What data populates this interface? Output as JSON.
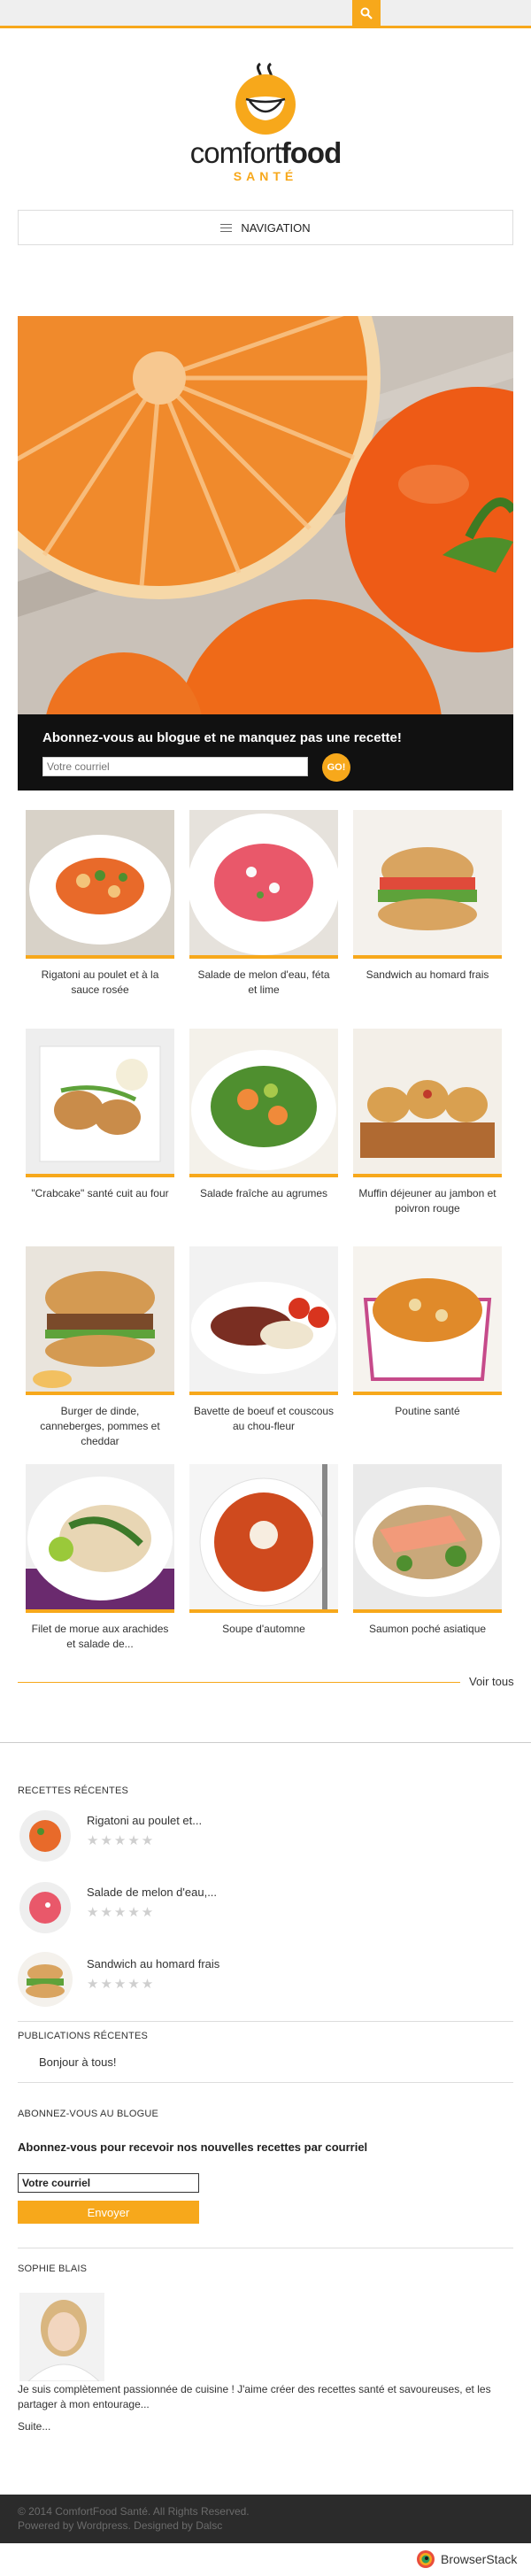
{
  "header": {
    "brand_main": "comfort",
    "brand_bold": "food",
    "brand_sub": "SANTÉ",
    "nav_label": "NAVIGATION"
  },
  "colors": {
    "accent": "#f7a81b",
    "dark": "#111111",
    "footer_bg": "#2b2b2b"
  },
  "subscribe_banner": {
    "title": "Abonnez-vous au blogue et ne manquez pas une recette!",
    "placeholder": "Votre courriel",
    "button": "GO!"
  },
  "recipes": [
    "Rigatoni au poulet et à la sauce rosée",
    "Salade de melon d'eau, féta et lime",
    "Sandwich au homard frais",
    "\"Crabcake\" santé cuit au four",
    "Salade fraîche au agrumes",
    "Muffin déjeuner au jambon et poivron rouge",
    "Burger de dinde, canneberges, pommes et cheddar",
    "Bavette de boeuf et couscous au chou-fleur",
    "Poutine santé",
    "Filet de morue aux arachides et salade de...",
    "Soupe d'automne",
    "Saumon poché asiatique"
  ],
  "see_all": "Voir tous",
  "sidebar": {
    "recent_recipes_title": "RECETTES RÉCENTES",
    "recent_recipes": [
      "Rigatoni au poulet et...",
      "Salade de melon d'eau,...",
      "Sandwich au homard frais"
    ],
    "stars": "★★★★★",
    "recent_posts_title": "PUBLICATIONS RÉCENTES",
    "recent_posts": [
      "Bonjour à tous!"
    ],
    "newsletter_title": "ABONNEZ-VOUS AU BLOGUE",
    "newsletter_text": "Abonnez-vous pour recevoir nos nouvelles recettes par courriel",
    "newsletter_value": "Votre courriel",
    "newsletter_button": "Envoyer",
    "author_title": "SOPHIE BLAIS",
    "author_bio": "Je suis complètement passionnée de cuisine ! J'aime créer des recettes santé et savoureuses, et les partager à mon entourage...",
    "author_more": "Suite..."
  },
  "footer": {
    "line1": "© 2014 ComfortFood Santé. All Rights Reserved.",
    "line2": "Powered by Wordpress. Designed by Dalsc"
  },
  "badge": {
    "label": "BrowserStack"
  }
}
